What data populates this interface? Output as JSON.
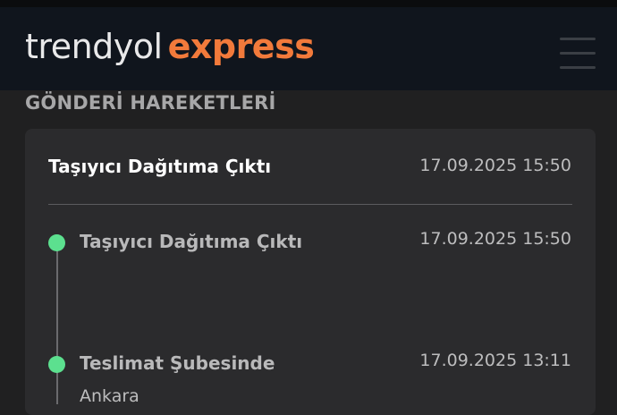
{
  "header": {
    "logo_brand": "trendyol",
    "logo_express": "express",
    "menu_icon": "hamburger-menu-icon",
    "accent_color": "#f27a3b"
  },
  "section": {
    "title": "GÖNDERİ HAREKETLERİ"
  },
  "current_status": {
    "title": "Taşıyıcı Dağıtıma Çıktı",
    "datetime": "17.09.2025 15:50"
  },
  "events": [
    {
      "title": "Taşıyıcı Dağıtıma Çıktı",
      "datetime": "17.09.2025 15:50",
      "location": ""
    },
    {
      "title": "Teslimat Şubesinde",
      "datetime": "17.09.2025 13:11",
      "location": "Ankara"
    }
  ],
  "colors": {
    "timeline_dot": "#5ce08f",
    "background": "#202021",
    "card": "#2b2b2d"
  }
}
